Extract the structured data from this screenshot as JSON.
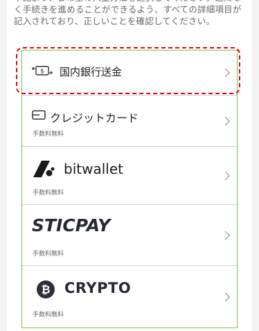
{
  "intro": {
    "text": "下記より、ご希望の入金方法を選択してください。遅滞なく手続きを進めることができるよう、すべての詳細項目が記入されており、正しいことを確認してください。"
  },
  "methods": [
    {
      "name": "bank",
      "label": "国内銀行送金",
      "icon": "bank-transfer-icon"
    },
    {
      "name": "card",
      "label": "クレジットカード",
      "fee": "手数料無料",
      "icon": "credit-card-icon"
    },
    {
      "name": "bitwallet",
      "label": "bitwallet",
      "fee": "手数料無料",
      "icon": "bitwallet-logo"
    },
    {
      "name": "sticpay",
      "label": "STICPAY",
      "fee": "手数料無料",
      "icon": "sticpay-logo"
    },
    {
      "name": "crypto",
      "label": "CRYPTO",
      "fee": "手数料無料",
      "icon": "bitcoin-icon"
    }
  ],
  "colors": {
    "accent_border": "#7cc242",
    "highlight": "#e0001b"
  }
}
